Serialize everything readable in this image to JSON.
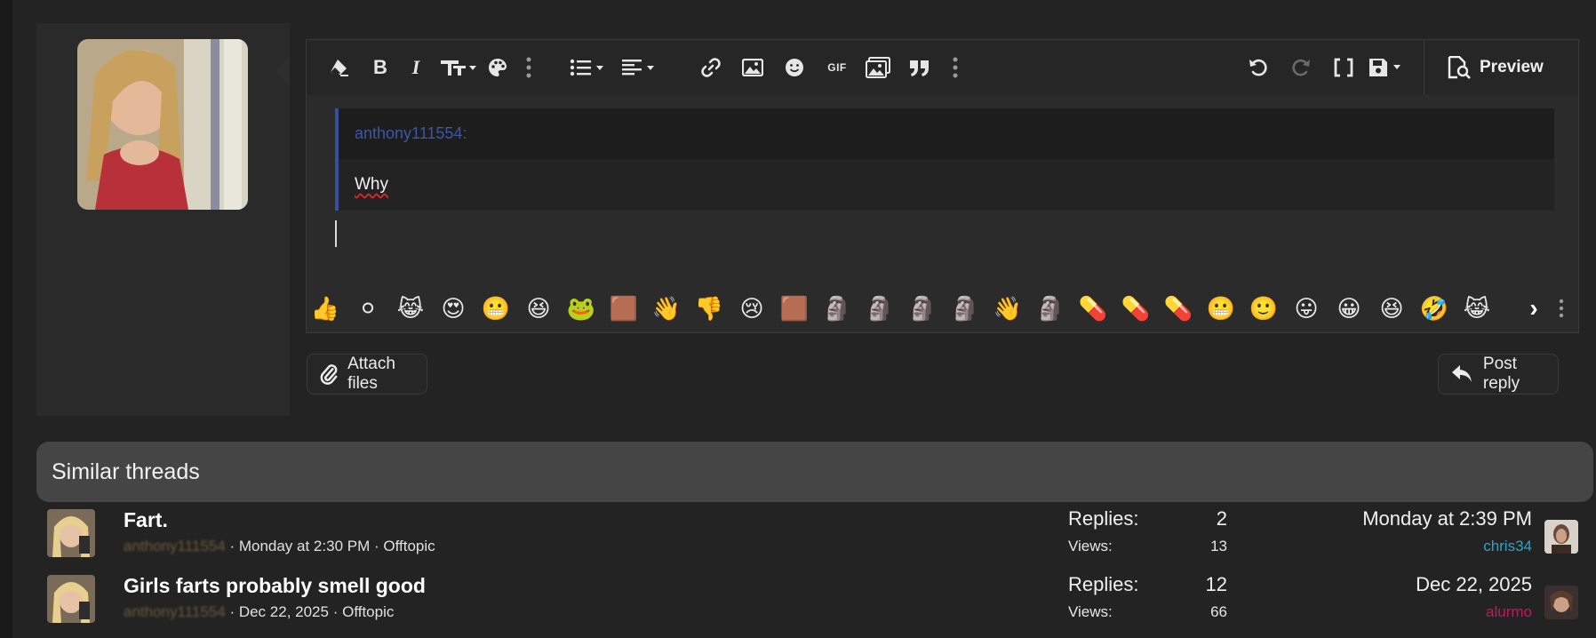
{
  "editor": {
    "toolbar": {
      "icons": [
        "eraser-icon",
        "bold-icon",
        "italic-icon",
        "text-size-icon",
        "palette-icon",
        "more-icon",
        "list-icon",
        "align-icon",
        "link-icon",
        "image-icon",
        "smiley-icon",
        "gif-icon",
        "media-icon",
        "quote-icon",
        "more-icon",
        "undo-icon",
        "redo-icon",
        "bbcode-icon",
        "save-draft-icon"
      ],
      "bold_label": "B",
      "italic_label": "I",
      "gif_label": "GIF",
      "preview_label": "Preview"
    },
    "quote": {
      "author": "anthony111554:",
      "text": "Why"
    },
    "emoji_bar": {
      "items": [
        "👍",
        "⚪",
        "😹",
        "😍",
        "😬",
        "😆",
        "🐸",
        "🟫",
        "👋",
        "👎",
        "😢",
        "🟫",
        "🗿",
        "🗿",
        "🗿",
        "🗿",
        "👋",
        "🗿",
        "💊",
        "💊",
        "💊",
        "😬",
        "🙂",
        "😛",
        "😀",
        "😆",
        "🤣",
        "😹"
      ],
      "next_label": "›"
    }
  },
  "actions": {
    "attach_label": "Attach files",
    "post_label": "Post reply"
  },
  "similar_threads": {
    "heading": "Similar threads",
    "threads": [
      {
        "title": "Fart.",
        "author": "anthony111554",
        "date": "Monday at 2:30 PM",
        "forum": "Offtopic",
        "replies_label": "Replies:",
        "replies": "2",
        "views_label": "Views:",
        "views": "13",
        "last_date": "Monday at 2:39 PM",
        "last_user": "chris34",
        "last_user_color": "#2ea3c9"
      },
      {
        "title": "Girls farts probably smell good",
        "author": "anthony111554",
        "date": "Dec 22, 2025",
        "forum": "Offtopic",
        "replies_label": "Replies:",
        "replies": "12",
        "views_label": "Views:",
        "views": "66",
        "last_date": "Dec 22, 2025",
        "last_user": "alurmo",
        "last_user_color": "#c2185b"
      }
    ]
  },
  "colors": {
    "quote_accent": "#3a4f9c",
    "background": "#232323"
  }
}
